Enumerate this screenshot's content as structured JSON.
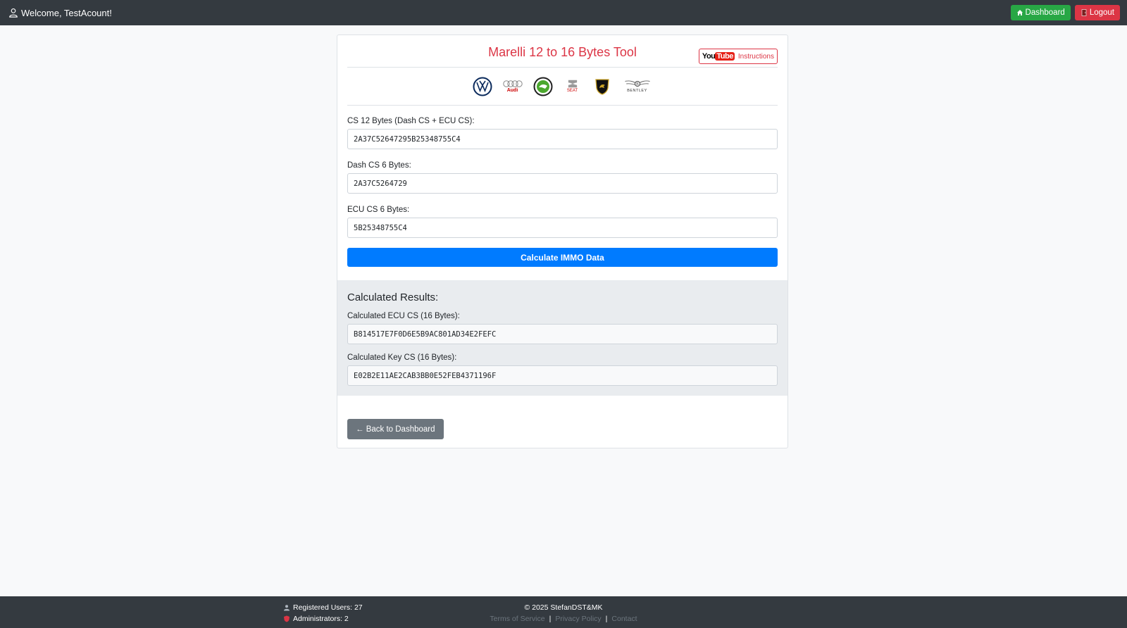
{
  "header": {
    "welcome_text": "Welcome, TestAcount!",
    "dashboard_label": "Dashboard",
    "logout_label": "Logout"
  },
  "tool": {
    "title": "Marelli 12 to 16 Bytes Tool",
    "yt_you": "You",
    "yt_tube": "Tube",
    "yt_label": "Instructions",
    "logos": [
      "vw-logo",
      "audi-logo",
      "skoda-logo",
      "seat-logo",
      "lamborghini-logo",
      "bentley-logo"
    ],
    "audi_text": "Audi",
    "seat_text": "SEAT",
    "bentley_text": "BENTLEY"
  },
  "form": {
    "cs12_label": "CS 12 Bytes (Dash CS + ECU CS):",
    "cs12_value": "2A37C52647295B25348755C4",
    "dash_label": "Dash CS 6 Bytes:",
    "dash_value": "2A37C5264729",
    "ecu_label": "ECU CS 6 Bytes:",
    "ecu_value": "5B25348755C4",
    "calculate_label": "Calculate IMMO Data"
  },
  "results": {
    "title": "Calculated Results:",
    "ecu_cs_label": "Calculated ECU CS (16 Bytes):",
    "ecu_cs_value": "B814517E7F0D6E5B9AC801AD34E2FEFC",
    "key_cs_label": "Calculated Key CS (16 Bytes):",
    "key_cs_value": "E02B2E11AE2CAB3BB0E52FEB4371196F"
  },
  "back_label": "← Back to Dashboard",
  "footer": {
    "registered_users": "Registered Users: 27",
    "administrators": "Administrators: 2",
    "copyright": "© 2025 StefanDST&MK",
    "terms": "Terms of Service",
    "privacy": "Privacy Policy",
    "contact": "Contact",
    "separator": "|"
  },
  "colors": {
    "nav_bg": "#343a40",
    "accent_red": "#dc3545",
    "primary_blue": "#007bff",
    "success_green": "#28a745",
    "secondary_gray": "#6c757d"
  }
}
